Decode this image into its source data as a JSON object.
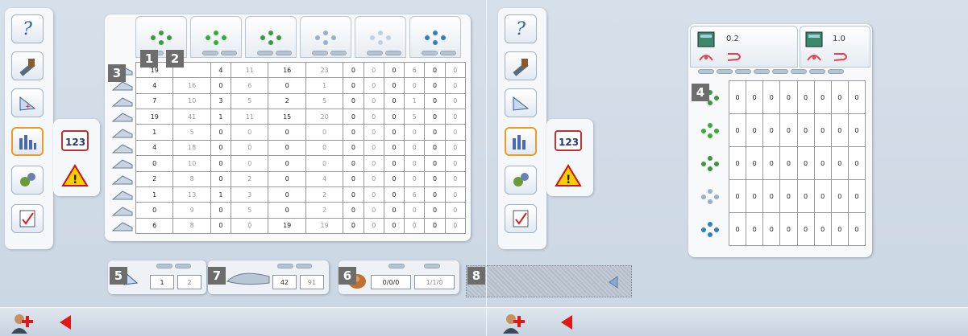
{
  "left": {
    "column_icons": [
      "bend-scatter-icon",
      "ring-scatter-icon",
      "bend-scatter-mask-icon",
      "triangle-icon",
      "diamond-icon",
      "cluster-icon"
    ],
    "row_icons": [
      "star-row-icon",
      "rect-row-icon",
      "wedge-row-icon",
      "box-row-icon",
      "cube-row-icon",
      "circle-row-icon",
      "curve-row-icon",
      "star2-row-icon",
      "slab-row-icon",
      "slab2-row-icon",
      "angled-row-icon"
    ],
    "rows": [
      [
        [
          "19",
          false
        ],
        [
          "",
          true
        ],
        [
          "4",
          false
        ],
        [
          "11",
          true
        ],
        [
          "16",
          false
        ],
        [
          "23",
          true
        ],
        [
          "0",
          false
        ],
        [
          "0",
          true
        ],
        [
          "0",
          false
        ],
        [
          "6",
          true
        ],
        [
          "0",
          false
        ],
        [
          "0",
          true
        ]
      ],
      [
        [
          "4",
          false
        ],
        [
          "16",
          true
        ],
        [
          "0",
          false
        ],
        [
          "6",
          true
        ],
        [
          "0",
          false
        ],
        [
          "1",
          true
        ],
        [
          "0",
          false
        ],
        [
          "0",
          true
        ],
        [
          "0",
          false
        ],
        [
          "0",
          true
        ],
        [
          "0",
          false
        ],
        [
          "0",
          true
        ]
      ],
      [
        [
          "7",
          false
        ],
        [
          "10",
          true
        ],
        [
          "3",
          false
        ],
        [
          "5",
          true
        ],
        [
          "2",
          false
        ],
        [
          "5",
          true
        ],
        [
          "0",
          false
        ],
        [
          "0",
          true
        ],
        [
          "0",
          false
        ],
        [
          "1",
          true
        ],
        [
          "0",
          false
        ],
        [
          "0",
          true
        ]
      ],
      [
        [
          "19",
          false
        ],
        [
          "41",
          true
        ],
        [
          "1",
          false
        ],
        [
          "11",
          true
        ],
        [
          "15",
          false
        ],
        [
          "20",
          true
        ],
        [
          "0",
          false
        ],
        [
          "0",
          true
        ],
        [
          "0",
          false
        ],
        [
          "5",
          true
        ],
        [
          "0",
          false
        ],
        [
          "0",
          true
        ]
      ],
      [
        [
          "1",
          false
        ],
        [
          "5",
          true
        ],
        [
          "0",
          false
        ],
        [
          "0",
          true
        ],
        [
          "0",
          false
        ],
        [
          "0",
          true
        ],
        [
          "0",
          false
        ],
        [
          "0",
          true
        ],
        [
          "0",
          false
        ],
        [
          "0",
          true
        ],
        [
          "0",
          false
        ],
        [
          "0",
          true
        ]
      ],
      [
        [
          "4",
          false
        ],
        [
          "18",
          true
        ],
        [
          "0",
          false
        ],
        [
          "0",
          true
        ],
        [
          "0",
          false
        ],
        [
          "0",
          true
        ],
        [
          "0",
          false
        ],
        [
          "0",
          true
        ],
        [
          "0",
          false
        ],
        [
          "0",
          true
        ],
        [
          "0",
          false
        ],
        [
          "0",
          true
        ]
      ],
      [
        [
          "0",
          false
        ],
        [
          "10",
          true
        ],
        [
          "0",
          false
        ],
        [
          "0",
          true
        ],
        [
          "0",
          false
        ],
        [
          "0",
          true
        ],
        [
          "0",
          false
        ],
        [
          "0",
          true
        ],
        [
          "0",
          false
        ],
        [
          "0",
          true
        ],
        [
          "0",
          false
        ],
        [
          "0",
          true
        ]
      ],
      [
        [
          "2",
          false
        ],
        [
          "8",
          true
        ],
        [
          "0",
          false
        ],
        [
          "2",
          true
        ],
        [
          "0",
          false
        ],
        [
          "4",
          true
        ],
        [
          "0",
          false
        ],
        [
          "0",
          true
        ],
        [
          "0",
          false
        ],
        [
          "0",
          true
        ],
        [
          "0",
          false
        ],
        [
          "0",
          true
        ]
      ],
      [
        [
          "1",
          false
        ],
        [
          "13",
          true
        ],
        [
          "1",
          false
        ],
        [
          "3",
          true
        ],
        [
          "0",
          false
        ],
        [
          "2",
          true
        ],
        [
          "0",
          false
        ],
        [
          "0",
          true
        ],
        [
          "0",
          false
        ],
        [
          "6",
          true
        ],
        [
          "0",
          false
        ],
        [
          "0",
          true
        ]
      ],
      [
        [
          "0",
          false
        ],
        [
          "9",
          true
        ],
        [
          "0",
          false
        ],
        [
          "5",
          true
        ],
        [
          "0",
          false
        ],
        [
          "2",
          true
        ],
        [
          "0",
          false
        ],
        [
          "0",
          true
        ],
        [
          "0",
          false
        ],
        [
          "0",
          true
        ],
        [
          "0",
          false
        ],
        [
          "0",
          true
        ]
      ],
      [
        [
          "6",
          false
        ],
        [
          "8",
          true
        ],
        [
          "0",
          false
        ],
        [
          "0",
          true
        ],
        [
          "19",
          false
        ],
        [
          "19",
          true
        ],
        [
          "0",
          false
        ],
        [
          "0",
          true
        ],
        [
          "0",
          false
        ],
        [
          "0",
          true
        ],
        [
          "0",
          false
        ],
        [
          "0",
          true
        ]
      ]
    ],
    "badges": {
      "b1": "1",
      "b2": "2",
      "b3": "3",
      "b5": "5",
      "b6": "6",
      "b7": "7",
      "b8": "8"
    },
    "sub5": {
      "a": "1",
      "b": "2"
    },
    "sub7": {
      "a": "42",
      "b": "91"
    },
    "sub6": {
      "a": "0/0/0",
      "b": "1/1/0"
    }
  },
  "right": {
    "headers": [
      "0.2",
      "1.0"
    ],
    "badge4": "4",
    "rows": [
      [
        "0",
        "0",
        "0",
        "0",
        "0",
        "0",
        "0",
        "0"
      ],
      [
        "0",
        "0",
        "0",
        "0",
        "0",
        "0",
        "0",
        "0"
      ],
      [
        "0",
        "0",
        "0",
        "0",
        "0",
        "0",
        "0",
        "0"
      ],
      [
        "0",
        "0",
        "0",
        "0",
        "0",
        "0",
        "0",
        "0"
      ],
      [
        "0",
        "0",
        "0",
        "0",
        "0",
        "0",
        "0",
        "0"
      ]
    ]
  },
  "colors": {
    "accent": "#f09a24",
    "warning": "#f5d000",
    "back": "#e01818"
  }
}
